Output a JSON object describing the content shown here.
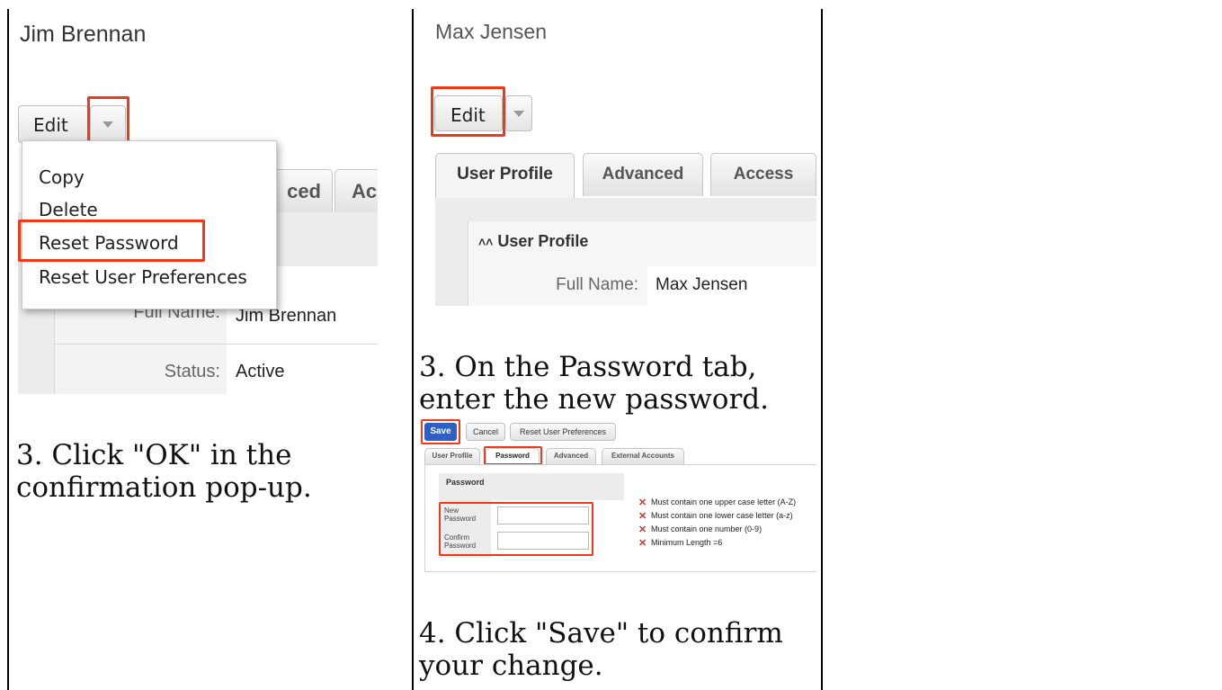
{
  "left_panel": {
    "title": "Jim Brennan",
    "edit_label": "Edit",
    "menu": [
      "Copy",
      "Delete",
      "Reset Password",
      "Reset User Preferences"
    ],
    "tab_fragment_1": "ced",
    "tab_fragment_2": "Ac",
    "full_name_label": "Full Name:",
    "full_name_value": "Jim Brennan",
    "status_label": "Status:",
    "status_value": "Active",
    "caption": "3. Click \"OK\" in the confirmation pop-up."
  },
  "middle_panel": {
    "title": "Max Jensen",
    "edit_label": "Edit",
    "tabs": [
      "User Profile",
      "Advanced",
      "Access"
    ],
    "section_title": "User Profile",
    "full_name_label": "Full Name:",
    "full_name_value": "Max Jensen",
    "caption_1": "3. On the Password tab, enter the new password.",
    "save_label": "Save",
    "cancel_label": "Cancel",
    "reset_prefs_label": "Reset User Preferences",
    "small_tabs": [
      "User Profile",
      "Password",
      "Advanced",
      "External Accounts"
    ],
    "password_header": "Password",
    "new_password_label": "New Password",
    "confirm_password_label": "Confirm Password",
    "rules": [
      "Must contain one upper case letter (A-Z)",
      "Must contain one lower case letter (a-z)",
      "Must contain one number (0-9)",
      "Minimum Length =6"
    ],
    "caption_2": "4. Click \"Save\" to confirm your change."
  },
  "colors": {
    "highlight": "#f03a17",
    "save_blue": "#2f5fc4",
    "error_x": "#c0392b"
  }
}
